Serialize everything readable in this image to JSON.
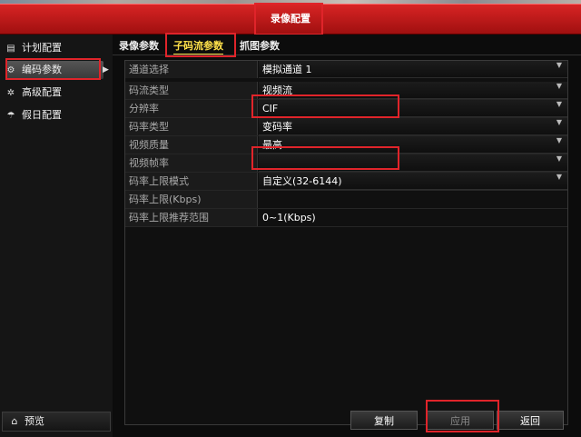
{
  "window": {
    "title": "录像配置"
  },
  "sidebar": {
    "items": [
      {
        "icon": "calendar-icon",
        "label": "计划配置"
      },
      {
        "icon": "gear-icon",
        "label": "编码参数"
      },
      {
        "icon": "advanced-icon",
        "label": "高级配置"
      },
      {
        "icon": "holiday-icon",
        "label": "假日配置"
      }
    ],
    "preview_label": "预览"
  },
  "tabs": [
    {
      "label": "录像参数"
    },
    {
      "label": "子码流参数"
    },
    {
      "label": "抓图参数"
    }
  ],
  "form": {
    "rows": [
      {
        "label": "通道选择",
        "value": "模拟通道 1",
        "dropdown": true
      },
      {
        "label": "码流类型",
        "value": "视频流",
        "dropdown": true
      },
      {
        "label": "分辨率",
        "value": "CIF",
        "dropdown": true
      },
      {
        "label": "码率类型",
        "value": "变码率",
        "dropdown": true
      },
      {
        "label": "视频质量",
        "value": "最高",
        "dropdown": true
      },
      {
        "label": "视频帧率",
        "value": "",
        "dropdown": true
      },
      {
        "label": "码率上限模式",
        "value": "自定义(32-6144)",
        "dropdown": true
      },
      {
        "label": "码率上限(Kbps)",
        "value": "",
        "dropdown": false
      },
      {
        "label": "码率上限推荐范围",
        "value": "0~1(Kbps)",
        "dropdown": false
      }
    ]
  },
  "buttons": {
    "copy": "复制",
    "apply": "应用",
    "back": "返回"
  },
  "colors": {
    "title_bar": "#c41818",
    "highlight": "#e0242a",
    "active_tab": "#ffe14a"
  }
}
